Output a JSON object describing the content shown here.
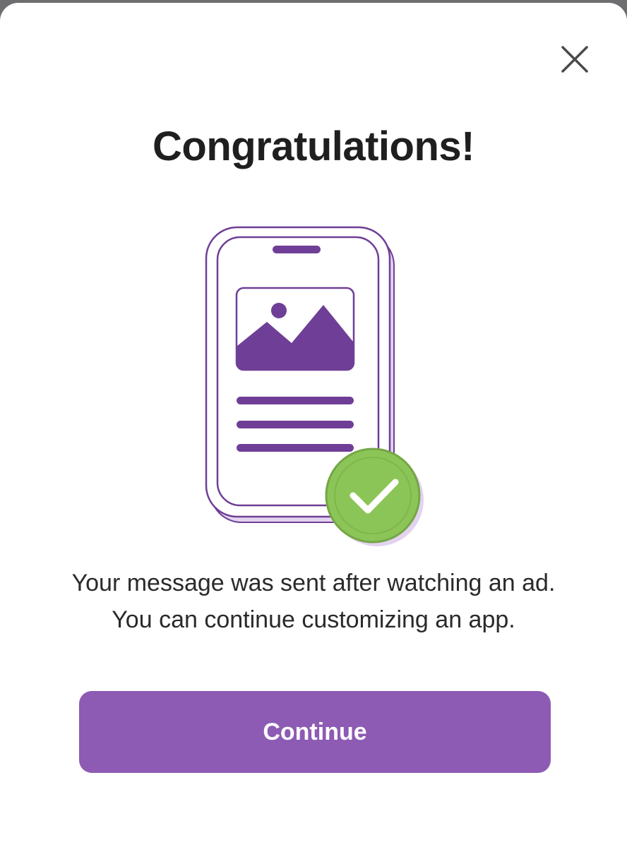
{
  "dialog": {
    "title": "Congratulations!",
    "message_line_1": "Your message was sent after watching an ad.",
    "message_line_2": "You can continue customizing an app.",
    "continue_label": "Continue",
    "close_icon": "close-icon"
  },
  "illustration": {
    "device": "phone-icon",
    "image": "image-icon",
    "badge": "checkmark-icon"
  },
  "colors": {
    "accent": "#8d5bb3",
    "illustration_purple": "#6f3f97",
    "success_green": "#8cc557",
    "title_text": "#1f1f1f",
    "body_text": "#2a2a2a"
  }
}
